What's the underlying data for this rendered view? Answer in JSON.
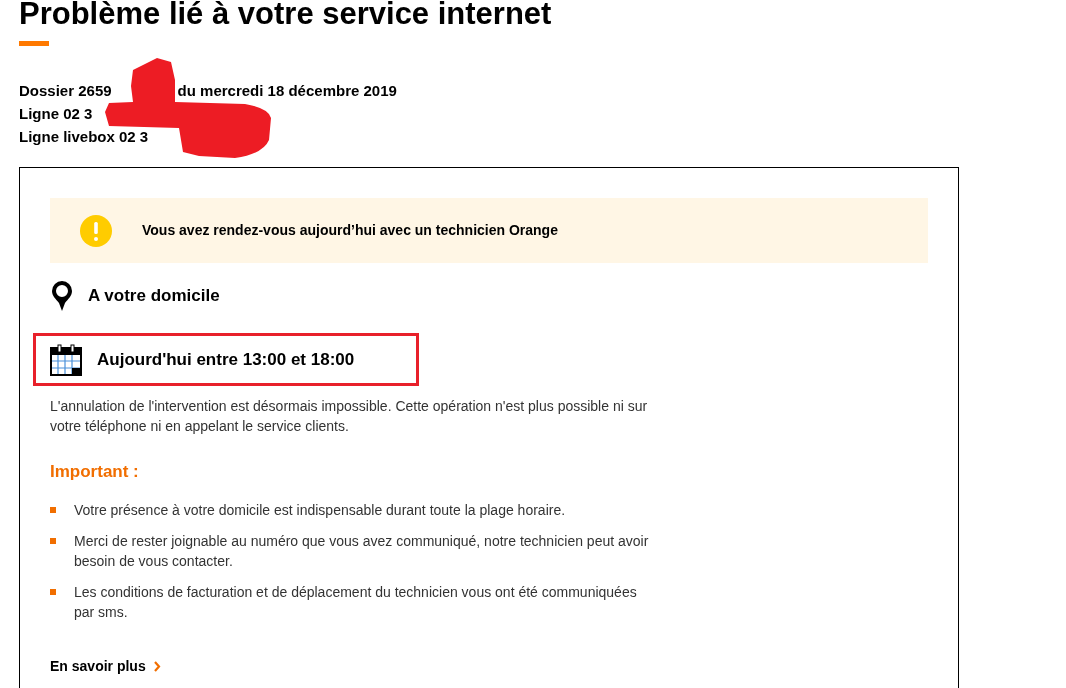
{
  "page": {
    "title": "Problème lié à votre service internet"
  },
  "case_info": [
    [
      "Dossier 2659",
      "du mercredi 18 décembre 2019"
    ],
    [
      "Ligne 02 3"
    ],
    [
      "Ligne livebox 02 3"
    ]
  ],
  "alert": {
    "kind": "warning",
    "text": "Vous avez rendez-vous aujourd’hui avec un technicien Orange"
  },
  "details": [
    {
      "kind": "location",
      "text": "A votre domicile",
      "highlighted": false
    },
    {
      "kind": "schedule",
      "text": "Aujourd'hui entre 13:00 et 18:00",
      "highlighted": true
    }
  ],
  "notice": "L'annulation de l'intervention est désormais impossible. Cette opération n'est plus possible ni sur votre téléphone ni en appelant le service clients.",
  "important": {
    "title": "Important :",
    "items": [
      "Votre présence à votre domicile est indispensable durant toute la plage horaire.",
      "Merci de rester joignable au numéro que vous avez communiqué, notre technicien peut avoir besoin de vous contacter.",
      "Les conditions de facturation et de déplacement du technicien vous ont été communiquées par sms."
    ]
  },
  "link": {
    "label": "En savoir plus"
  }
}
